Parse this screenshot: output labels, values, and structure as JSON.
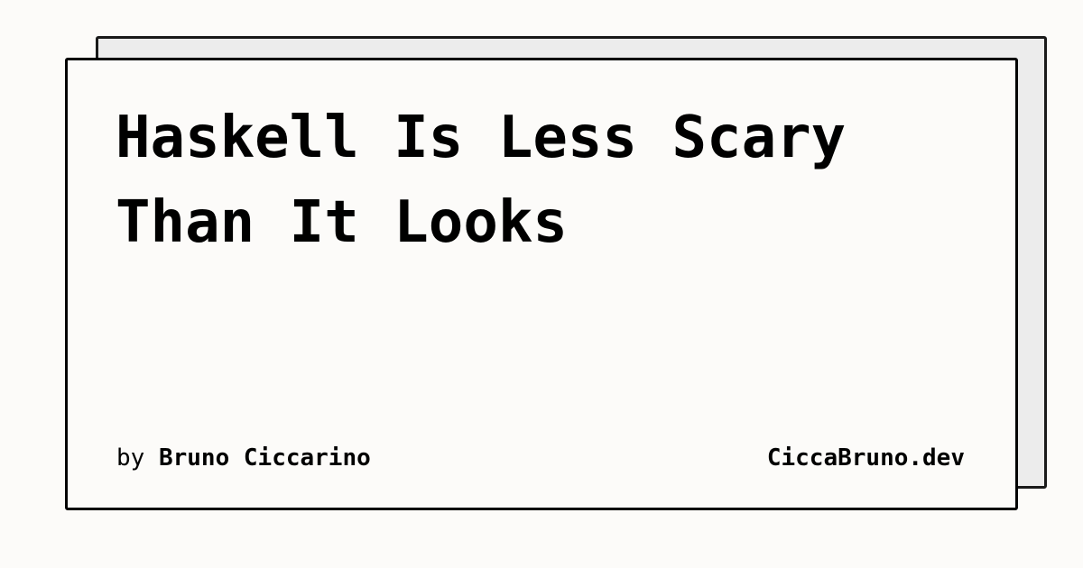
{
  "title": {
    "line1": "Haskell Is Less Scary",
    "line2": "Than It Looks"
  },
  "byline": {
    "prefix": "by",
    "author": "Bruno Ciccarino"
  },
  "site": "CiccaBruno.dev",
  "colors": {
    "background": "#fcfbf9",
    "back_card": "#ececec",
    "border": "#000000",
    "text": "#000000"
  }
}
